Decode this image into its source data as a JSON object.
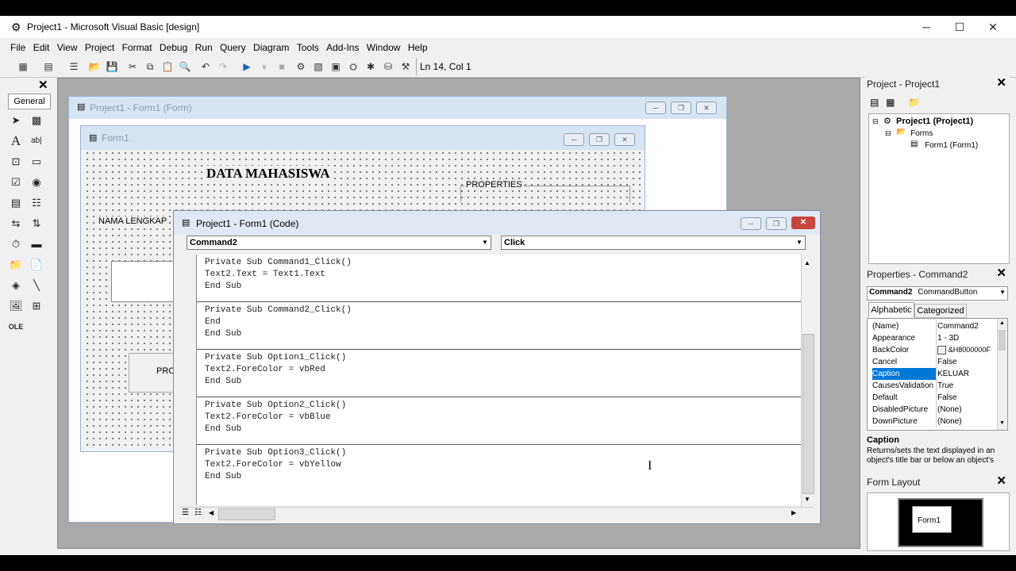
{
  "window": {
    "title": "Project1 - Microsoft Visual Basic [design]"
  },
  "menu": [
    "File",
    "Edit",
    "View",
    "Project",
    "Format",
    "Debug",
    "Run",
    "Query",
    "Diagram",
    "Tools",
    "Add-Ins",
    "Window",
    "Help"
  ],
  "toolbar": {
    "position": "Ln 14, Col 1"
  },
  "toolbox": {
    "tab_label": "General"
  },
  "form_designer": {
    "window_title": "Project1 - Form1 (Form)",
    "form_title": "Form1",
    "heading": "DATA MAHASISWA",
    "label_nama": "NAMA LENGKAP",
    "frame_label": "PROPERTIES",
    "button_partial": "PRO"
  },
  "code_window": {
    "title": "Project1 - Form1 (Code)",
    "object_combo": "Command2",
    "procedure_combo": "Click",
    "procedures": [
      "Private Sub Command1_Click()\nText2.Text = Text1.Text\nEnd Sub",
      "Private Sub Command2_Click()\nEnd\nEnd Sub",
      "Private Sub Option1_Click()\nText2.ForeColor = vbRed\nEnd Sub",
      "Private Sub Option2_Click()\nText2.ForeColor = vbBlue\nEnd Sub",
      "Private Sub Option3_Click()\nText2.ForeColor = vbYellow\nEnd Sub"
    ]
  },
  "project_panel": {
    "title": "Project - Project1",
    "root": "Project1 (Project1)",
    "folder": "Forms",
    "item": "Form1 (Form1)"
  },
  "properties_panel": {
    "title": "Properties - Command2",
    "object_name": "Command2",
    "object_type": "CommandButton",
    "tab_alpha": "Alphabetic",
    "tab_cat": "Categorized",
    "rows": [
      {
        "key": "(Name)",
        "value": "Command2"
      },
      {
        "key": "Appearance",
        "value": "1 - 3D"
      },
      {
        "key": "BackColor",
        "value": "&H8000000F"
      },
      {
        "key": "Cancel",
        "value": "False"
      },
      {
        "key": "Caption",
        "value": "KELUAR"
      },
      {
        "key": "CausesValidation",
        "value": "True"
      },
      {
        "key": "Default",
        "value": "False"
      },
      {
        "key": "DisabledPicture",
        "value": "(None)"
      },
      {
        "key": "DownPicture",
        "value": "(None)"
      }
    ],
    "desc_title": "Caption",
    "desc_text": "Returns/sets the text displayed in an object's title bar or below an object's"
  },
  "form_layout": {
    "title": "Form Layout",
    "form_label": "Form1"
  },
  "colors": {
    "selection": "#0078d7",
    "titlebar_inactive": "#d7e4f2"
  }
}
